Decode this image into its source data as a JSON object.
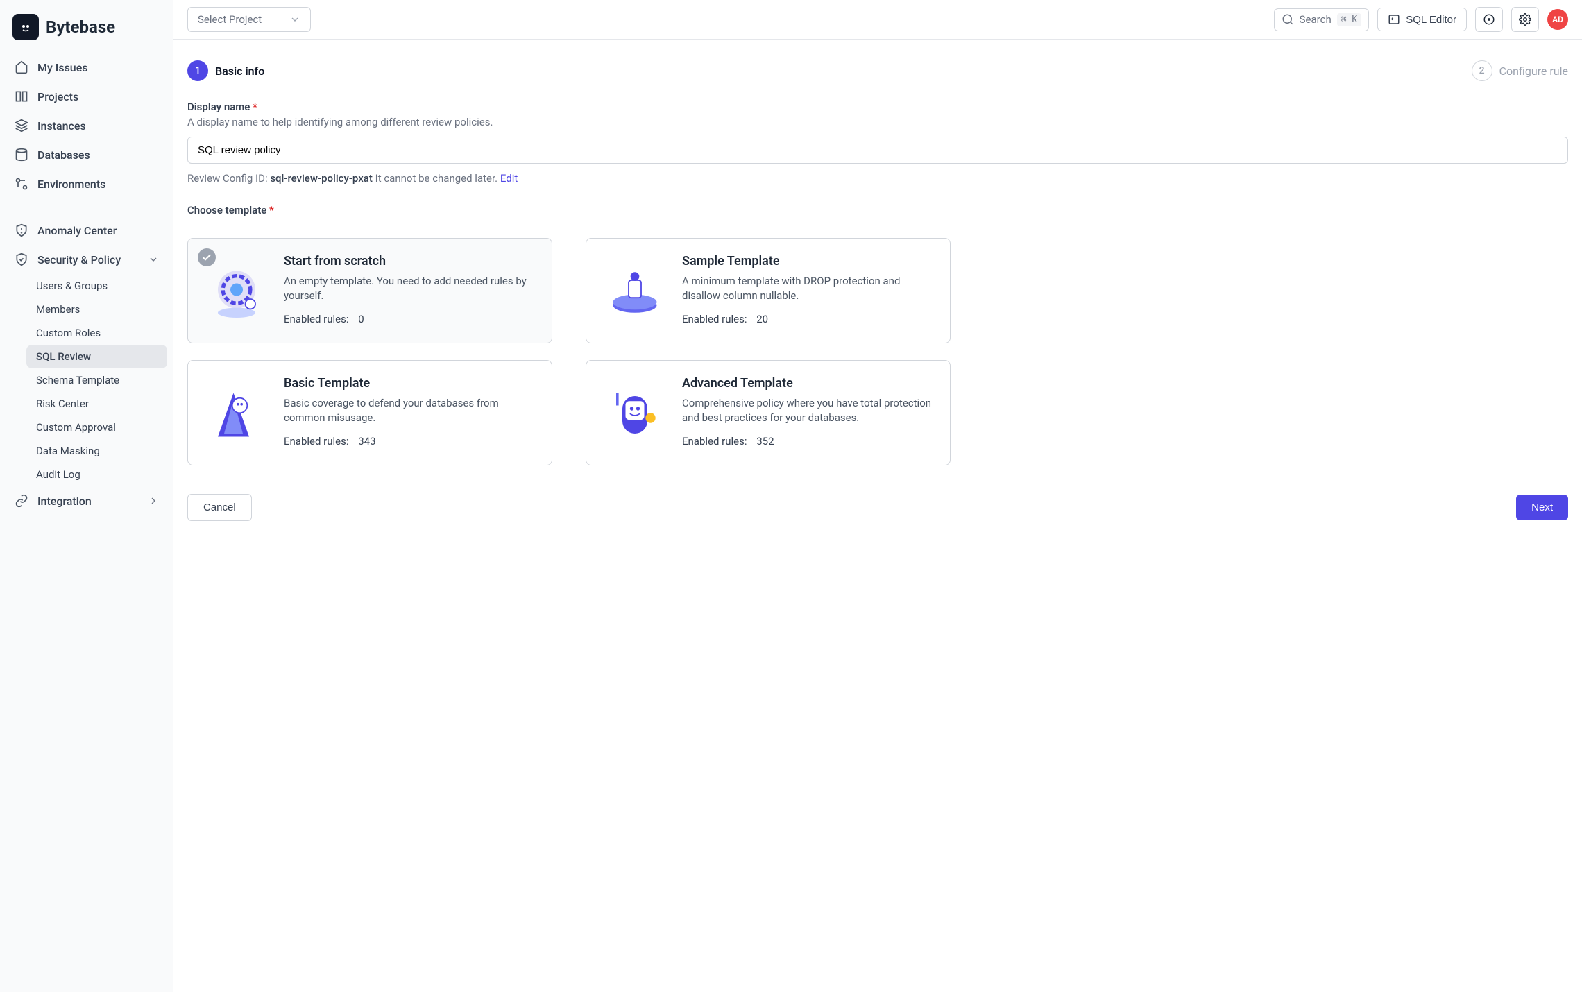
{
  "brand": "Bytebase",
  "topbar": {
    "project_select": "Select Project",
    "search_placeholder": "Search",
    "search_shortcut": "⌘ K",
    "sql_editor": "SQL Editor",
    "avatar_initials": "AD"
  },
  "sidebar": {
    "items": [
      {
        "label": "My Issues"
      },
      {
        "label": "Projects"
      },
      {
        "label": "Instances"
      },
      {
        "label": "Databases"
      },
      {
        "label": "Environments"
      }
    ],
    "section2": [
      {
        "label": "Anomaly Center"
      },
      {
        "label": "Security & Policy",
        "expanded": true
      }
    ],
    "security_sub": [
      {
        "label": "Users & Groups"
      },
      {
        "label": "Members"
      },
      {
        "label": "Custom Roles"
      },
      {
        "label": "SQL Review",
        "active": true
      },
      {
        "label": "Schema Template"
      },
      {
        "label": "Risk Center"
      },
      {
        "label": "Custom Approval"
      },
      {
        "label": "Data Masking"
      },
      {
        "label": "Audit Log"
      }
    ],
    "integration": {
      "label": "Integration"
    }
  },
  "stepper": {
    "step1": {
      "num": "1",
      "label": "Basic info"
    },
    "step2": {
      "num": "2",
      "label": "Configure rule"
    }
  },
  "form": {
    "display_name_label": "Display name",
    "display_name_hint": "A display name to help identifying among different review policies.",
    "display_name_value": "SQL review policy",
    "review_id_prefix": "Review Config ID:",
    "review_id_value": "sql-review-policy-pxat",
    "review_id_note": "It cannot be changed later.",
    "review_id_edit": "Edit"
  },
  "templates_label": "Choose template",
  "rules_label": "Enabled rules:",
  "templates": [
    {
      "title": "Start from scratch",
      "desc": "An empty template. You need to add needed rules by yourself.",
      "rules": "0",
      "selected": true
    },
    {
      "title": "Sample Template",
      "desc": "A minimum template with DROP protection and disallow column nullable.",
      "rules": "20"
    },
    {
      "title": "Basic Template",
      "desc": "Basic coverage to defend your databases from common misusage.",
      "rules": "343"
    },
    {
      "title": "Advanced Template",
      "desc": "Comprehensive policy where you have total protection and best practices for your databases.",
      "rules": "352"
    }
  ],
  "footer": {
    "cancel": "Cancel",
    "next": "Next"
  }
}
